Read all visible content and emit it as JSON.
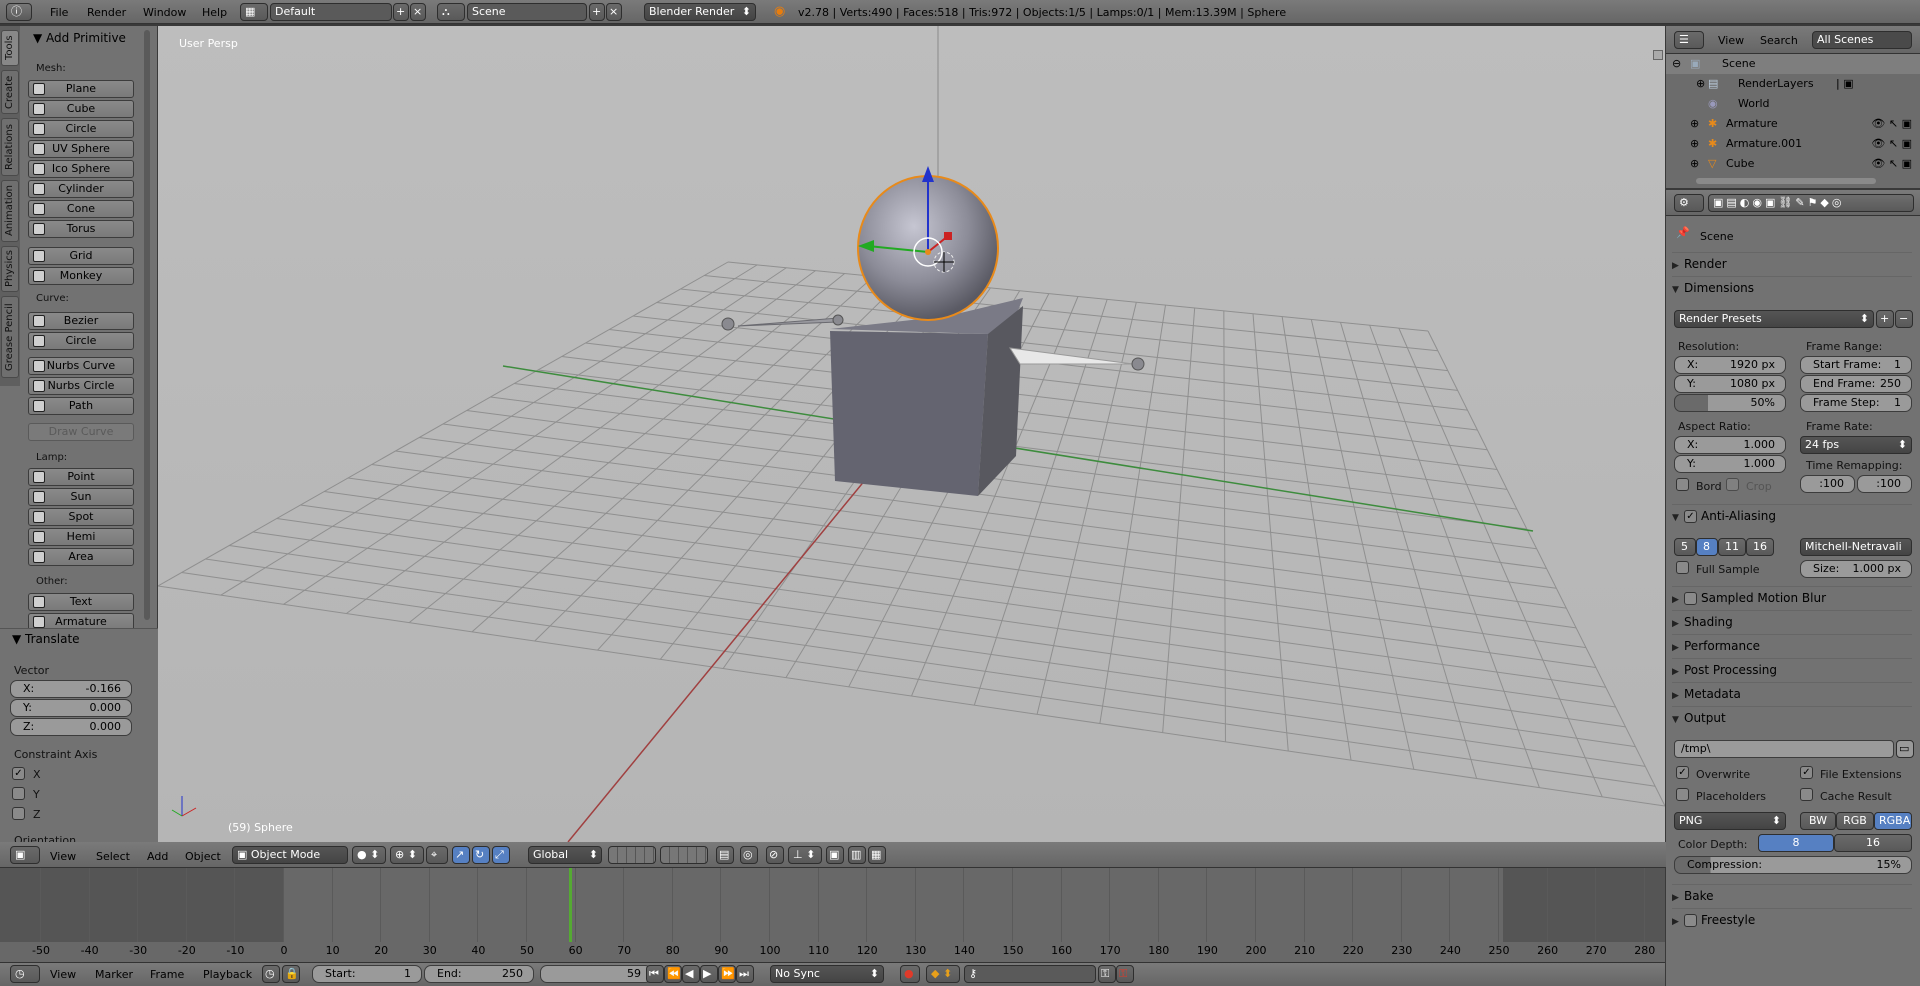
{
  "topbar": {
    "menu": [
      "File",
      "Render",
      "Window",
      "Help"
    ],
    "layout": "Default",
    "scene": "Scene",
    "engine": "Blender Render",
    "stats": "v2.78 | Verts:490 | Faces:518 | Tris:972 | Objects:1/5 | Lamps:0/1 | Mem:13.39M | Sphere"
  },
  "tool_tabs": [
    "Tools",
    "Create",
    "Relations",
    "Animation",
    "Physics",
    "Grease Pencil"
  ],
  "add_primitive": {
    "title": "Add Primitive",
    "mesh_label": "Mesh:",
    "mesh": [
      "Plane",
      "Cube",
      "Circle",
      "UV Sphere",
      "Ico Sphere",
      "Cylinder",
      "Cone",
      "Torus"
    ],
    "mesh2": [
      "Grid",
      "Monkey"
    ],
    "curve_label": "Curve:",
    "curve": [
      "Bezier",
      "Circle"
    ],
    "curve2": [
      "Nurbs Curve",
      "Nurbs Circle",
      "Path"
    ],
    "draw_curve": "Draw Curve",
    "lamp_label": "Lamp:",
    "lamp": [
      "Point",
      "Sun",
      "Spot",
      "Hemi",
      "Area"
    ],
    "other_label": "Other:",
    "other": [
      "Text",
      "Armature"
    ]
  },
  "translate": {
    "title": "Translate",
    "vector_label": "Vector",
    "x_label": "X:",
    "x": "-0.166",
    "y_label": "Y:",
    "y": "0.000",
    "z_label": "Z:",
    "z": "0.000",
    "constraint_label": "Constraint Axis",
    "axes": [
      "X",
      "Y",
      "Z"
    ],
    "orientation_label": "Orientation"
  },
  "viewport": {
    "view_name": "User Persp",
    "object_label": "(59) Sphere"
  },
  "view3d_header": {
    "menus": [
      "View",
      "Select",
      "Add",
      "Object"
    ],
    "mode": "Object Mode",
    "orientation": "Global"
  },
  "outliner": {
    "menus": [
      "View",
      "Search"
    ],
    "filter": "All Scenes",
    "items": [
      "Scene",
      "RenderLayers",
      "World",
      "Armature",
      "Armature.001",
      "Cube"
    ]
  },
  "properties": {
    "context": "Scene",
    "panels": {
      "render": "Render",
      "dimensions": "Dimensions",
      "render_presets": "Render Presets",
      "resolution_label": "Resolution:",
      "res_x_label": "X:",
      "res_x": "1920 px",
      "res_y_label": "Y:",
      "res_y": "1080 px",
      "res_pct": "50%",
      "frame_range_label": "Frame Range:",
      "start_label": "Start Frame:",
      "start": "1",
      "end_label": "End Frame:",
      "end": "250",
      "step_label": "Frame Step:",
      "step": "1",
      "aspect_label": "Aspect Ratio:",
      "asp_x_label": "X:",
      "asp_x": "1.000",
      "asp_y_label": "Y:",
      "asp_y": "1.000",
      "frame_rate_label": "Frame Rate:",
      "fps": "24 fps",
      "time_remap_label": "Time Remapping:",
      "remap_old": ":100",
      "remap_new": ":100",
      "bord": "Bord",
      "crop": "Crop",
      "aa": "Anti-Aliasing",
      "aa_samples": [
        "5",
        "8",
        "11",
        "16"
      ],
      "aa_filter": "Mitchell-Netravali",
      "full_sample": "Full Sample",
      "size_label": "Size:",
      "size": "1.000 px",
      "motion_blur": "Sampled Motion Blur",
      "shading": "Shading",
      "performance": "Performance",
      "post_processing": "Post Processing",
      "metadata": "Metadata",
      "output": "Output",
      "output_path": "/tmp\\",
      "overwrite": "Overwrite",
      "file_ext": "File Extensions",
      "placeholders": "Placeholders",
      "cache_result": "Cache Result",
      "format": "PNG",
      "color_modes": [
        "BW",
        "RGB",
        "RGBA"
      ],
      "color_depth_label": "Color Depth:",
      "depths": [
        "8",
        "16"
      ],
      "compression_label": "Compression:",
      "compression": "15%",
      "bake": "Bake",
      "freestyle": "Freestyle"
    }
  },
  "timeline": {
    "ticks": [
      "-50",
      "-40",
      "-30",
      "-20",
      "-10",
      "0",
      "10",
      "20",
      "30",
      "40",
      "50",
      "60",
      "70",
      "80",
      "90",
      "100",
      "110",
      "120",
      "130",
      "140",
      "150",
      "160",
      "170",
      "180",
      "190",
      "200",
      "210",
      "220",
      "230",
      "240",
      "250",
      "260",
      "270",
      "280"
    ],
    "menus": [
      "View",
      "Marker",
      "Frame",
      "Playback"
    ],
    "start_label": "Start:",
    "start": "1",
    "end_label": "End:",
    "end": "250",
    "current": "59",
    "sync": "No Sync",
    "current_frame_value": 59
  }
}
